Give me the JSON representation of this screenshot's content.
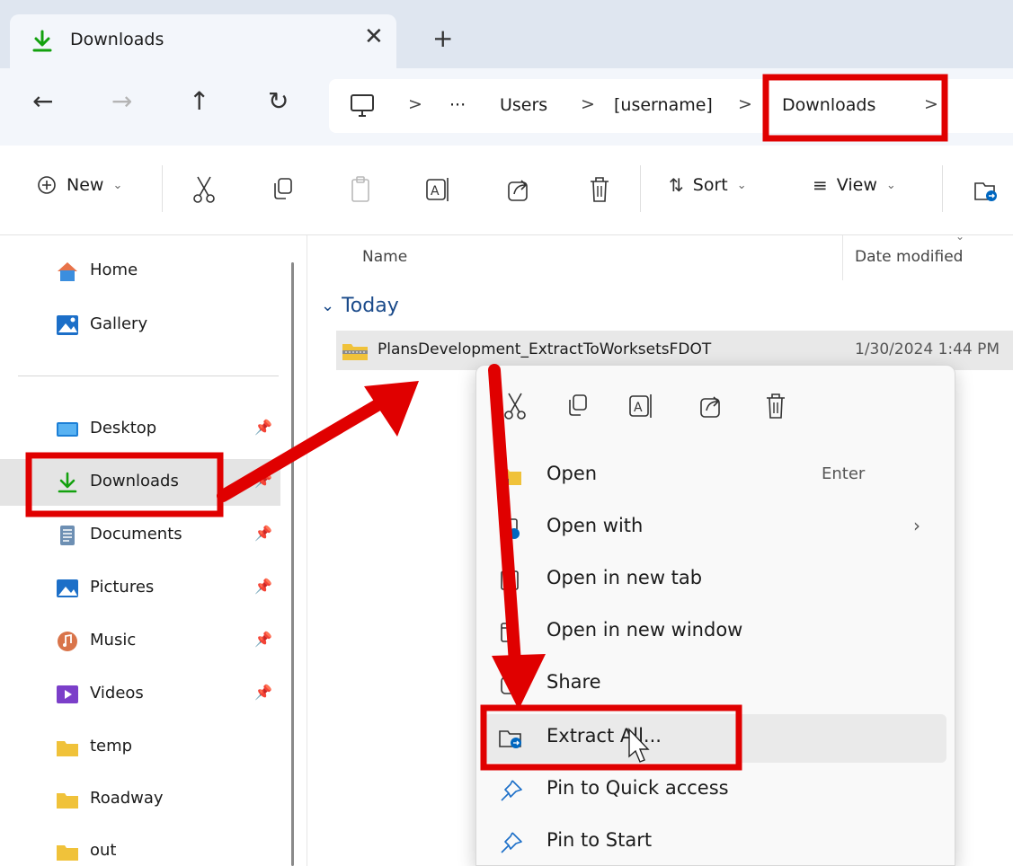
{
  "window": {
    "tab_title": "Downloads",
    "tab_close": "✕",
    "tab_new": "+"
  },
  "nav": {
    "back": "←",
    "forward": "→",
    "up": "↑",
    "refresh": "↻",
    "more": "···",
    "separator": ">",
    "breadcrumbs": [
      "Users",
      "[username]",
      "Downloads"
    ]
  },
  "toolbar": {
    "new_label": "New",
    "sort_label": "Sort",
    "view_label": "View",
    "caret": "⌄"
  },
  "sidebar": {
    "pin": "📌",
    "quick": [
      {
        "label": "Home",
        "icon": "home-icon"
      },
      {
        "label": "Gallery",
        "icon": "gallery-icon"
      }
    ],
    "places": [
      {
        "label": "Desktop",
        "icon": "desktop-folder-icon",
        "pinned": true
      },
      {
        "label": "Downloads",
        "icon": "download-icon",
        "pinned": true,
        "selected": true
      },
      {
        "label": "Documents",
        "icon": "documents-icon",
        "pinned": true
      },
      {
        "label": "Pictures",
        "icon": "pictures-icon",
        "pinned": true
      },
      {
        "label": "Music",
        "icon": "music-icon",
        "pinned": true
      },
      {
        "label": "Videos",
        "icon": "videos-icon",
        "pinned": true
      },
      {
        "label": "temp",
        "icon": "folder-icon",
        "pinned": false
      },
      {
        "label": "Roadway",
        "icon": "folder-icon",
        "pinned": false
      },
      {
        "label": "out",
        "icon": "folder-icon",
        "pinned": false
      }
    ]
  },
  "list": {
    "col_name": "Name",
    "col_date": "Date modified",
    "col_chevron": "⌄",
    "group": "Today",
    "group_chevron": "⌄",
    "files": [
      {
        "name": "PlansDevelopment_ExtractToWorksetsFDOT",
        "date": "1/30/2024 1:44 PM"
      }
    ]
  },
  "context_menu": {
    "items": [
      {
        "label": "Open",
        "shortcut": "Enter"
      },
      {
        "label": "Open with",
        "submenu": "›"
      },
      {
        "label": "Open in new tab"
      },
      {
        "label": "Open in new window"
      },
      {
        "label": "Share"
      },
      {
        "label": "Extract All..."
      },
      {
        "label": "Pin to Quick access"
      },
      {
        "label": "Pin to Start"
      }
    ]
  },
  "colors": {
    "annotation_red": "#e00000",
    "accent_blue": "#0067c0",
    "download_green": "#13a10e",
    "folder_yellow": "#f0c23a"
  }
}
